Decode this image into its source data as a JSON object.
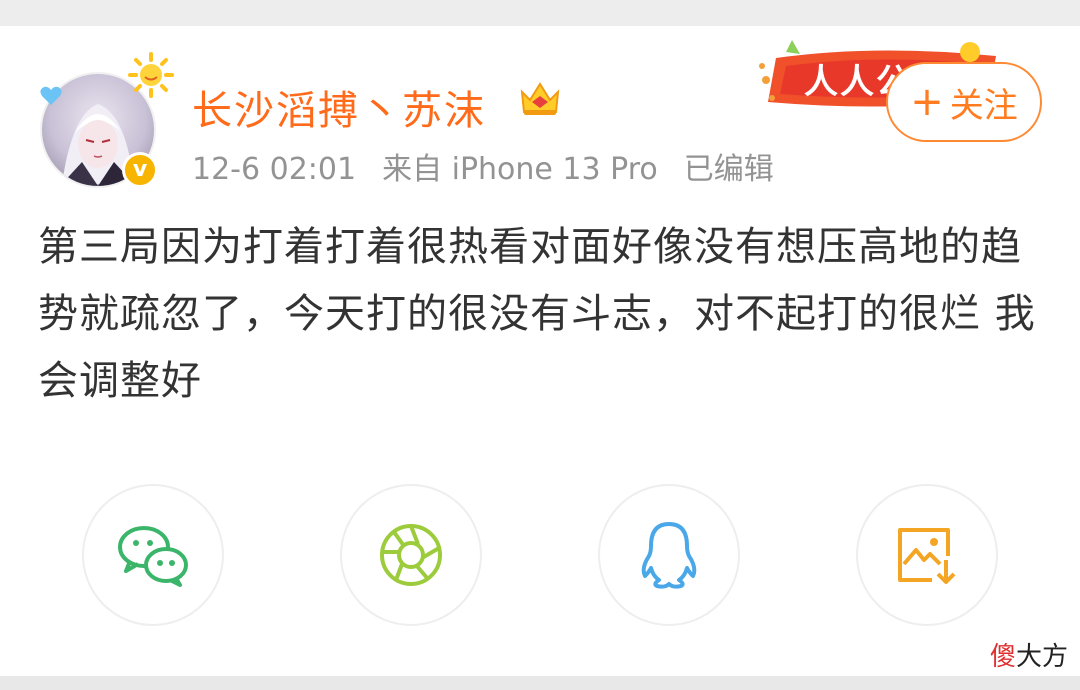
{
  "post": {
    "username": "长沙滔搏丶苏沫",
    "time": "12-6 02:01",
    "source": "来自 iPhone 13 Pro",
    "edited": "已编辑",
    "follow_plus": "+",
    "follow_label": "关注",
    "banner_text": "人人公",
    "content": "第三局因为打着打着很热看对面好像没有想压高地的趋势就疏忽了，今天打的很没有斗志，对不起打的很烂 我会调整好"
  },
  "share": [
    {
      "icon": "wechat-icon",
      "color": "#3bb56a"
    },
    {
      "icon": "moments-icon",
      "color": "#9ccc3c"
    },
    {
      "icon": "qq-icon",
      "color": "#4aa8e8"
    },
    {
      "icon": "save-image-icon",
      "color": "#f5a524"
    }
  ],
  "watermark": {
    "first": "傻",
    "rest": "大方"
  },
  "colors": {
    "username": "#ff6b1a",
    "accent": "#ff7d20",
    "meta": "#939393",
    "text": "#333333"
  }
}
